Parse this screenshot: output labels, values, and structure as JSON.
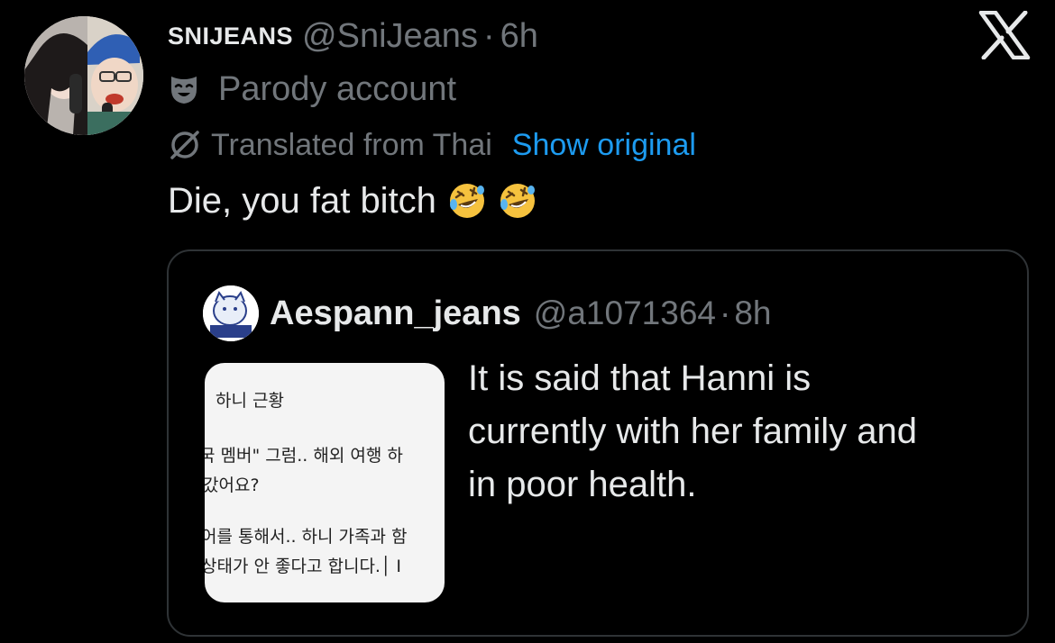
{
  "tweet": {
    "display_name": "SNIJEANS",
    "handle": "@SniJeans",
    "separator": "·",
    "time": "6h",
    "parody_label": "Parody account",
    "translated_label": "Translated from Thai",
    "show_original_label": "Show original",
    "text": "Die, you fat bitch",
    "emojis": [
      "rolling-on-floor-laughing",
      "rolling-on-floor-laughing"
    ]
  },
  "quote": {
    "display_name": "Aespann_jeans",
    "handle": "@a1071364",
    "separator": "·",
    "time": "8h",
    "text_lines": [
      "It is said that Hanni is",
      "currently with her family and",
      "in poor health."
    ],
    "image_text_lines": [
      "하니 근황",
      "국 멤버\" 그럼.. 해외 여행 하",
      "갔어요?",
      "어를 통해서.. 하니 가족과 함",
      "상태가 안 좋다고 합니다.│ I"
    ]
  },
  "colors": {
    "background": "#000000",
    "primary_text": "#e7e9ea",
    "secondary_text": "#71767b",
    "link": "#1d9bf0",
    "border": "#2f3336",
    "emoji_yellow": "#f6c23e"
  },
  "icons": {
    "logo": "x-logo-icon",
    "parody": "mask-icon",
    "translate": "globe-slash-icon"
  }
}
